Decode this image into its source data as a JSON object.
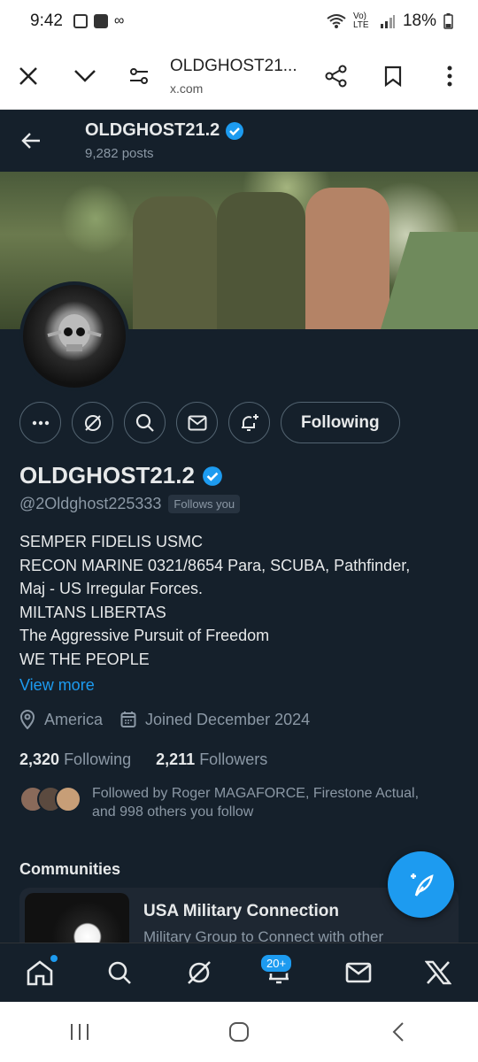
{
  "status_bar": {
    "time": "9:42",
    "battery": "18%",
    "network": "Vo) LTE"
  },
  "browser": {
    "title": "OLDGHOST21...",
    "domain": "x.com"
  },
  "profile_header": {
    "name": "OLDGHOST21.2",
    "posts": "9,282 posts"
  },
  "profile": {
    "display_name": "OLDGHOST21.2",
    "handle": "@2Oldghost225333",
    "follows_you": "Follows you",
    "following_label": "Following",
    "bio_lines": [
      "SEMPER FIDELIS USMC",
      "RECON MARINE 0321/8654 Para, SCUBA, Pathfinder,",
      "Maj - US Irregular Forces.",
      "MILTANS LIBERTAS",
      "The Aggressive Pursuit of Freedom",
      "WE THE PEOPLE"
    ],
    "view_more": "View more",
    "location": "America",
    "joined": "Joined December 2024",
    "following_count": "2,320",
    "following_text": "Following",
    "followers_count": "2,211",
    "followers_text": "Followers",
    "followed_by_line1": "Followed by Roger MAGAFORCE, Firestone Actual,",
    "followed_by_line2": "and 998 others you follow"
  },
  "communities": {
    "label": "Communities",
    "card_title": "USA Military Connection",
    "card_subtitle": "Military Group to Connect with other"
  },
  "tab_bar": {
    "notifications_badge": "20+"
  },
  "colors": {
    "accent": "#1d9bf0",
    "background": "#15202b",
    "muted": "#8b98a5"
  }
}
